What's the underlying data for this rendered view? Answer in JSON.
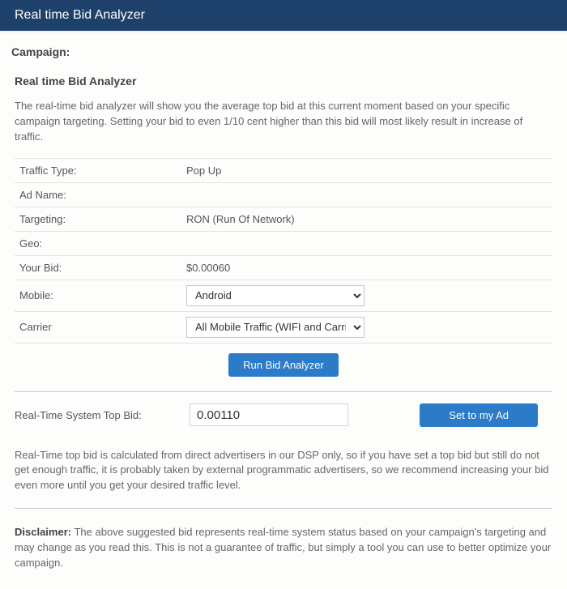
{
  "header": {
    "title": "Real time Bid Analyzer"
  },
  "campaign": {
    "label": "Campaign:"
  },
  "panel": {
    "title": "Real time Bid Analyzer",
    "intro": "The real-time bid analyzer will show you the average top bid at this current moment based on your specific campaign targeting. Setting your bid to even 1/10 cent higher than this bid will most likely result in increase of traffic."
  },
  "rows": {
    "traffic_type": {
      "label": "Traffic Type:",
      "value": "Pop Up"
    },
    "ad_name": {
      "label": "Ad Name:",
      "value": ""
    },
    "targeting": {
      "label": "Targeting:",
      "value": "RON (Run Of Network)"
    },
    "geo": {
      "label": "Geo:",
      "value": ""
    },
    "your_bid": {
      "label": "Your Bid:",
      "value": "$0.00060"
    },
    "mobile": {
      "label": "Mobile:",
      "selected": "Android"
    },
    "carrier": {
      "label": "Carrier",
      "selected": "All Mobile Traffic (WIFI and Carrier)"
    }
  },
  "actions": {
    "run_label": "Run Bid Analyzer",
    "set_label": "Set to my Ad"
  },
  "topbid": {
    "label": "Real-Time System Top Bid:",
    "value": "0.00110"
  },
  "note": "Real-Time top bid is calculated from direct advertisers in our DSP only, so if you have set a top bid but still do not get enough traffic, it is probably taken by external programmatic advertisers, so we recommend increasing your bid even more until you get your desired traffic level.",
  "disclaimer": {
    "label": "Disclaimer:",
    "text": " The above suggested bid represents real-time system status based on your campaign's targeting and may change as you read this. This is not a guarantee of traffic, but simply a tool you can use to better optimize your campaign."
  }
}
